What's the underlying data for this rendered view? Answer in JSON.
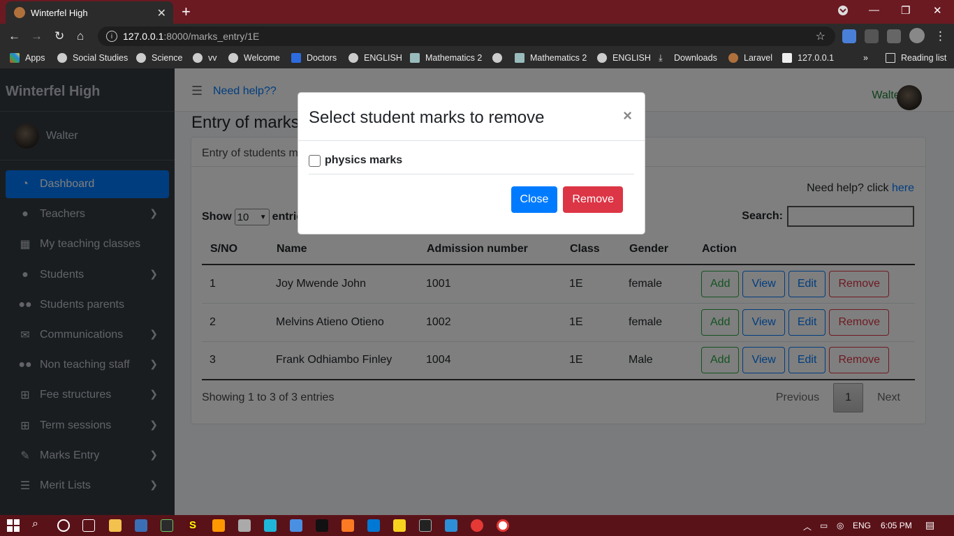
{
  "browser": {
    "tab_title": "Winterfel High",
    "tab_close": "✕",
    "new_tab": "+",
    "url_host": "127.0.0.1",
    "url_path": ":8000/marks_entry/1E",
    "bookmarks": [
      "Apps",
      "Social Studies",
      "Science",
      "vv",
      "Welcome",
      "Doctors",
      "ENGLISH",
      "Mathematics 2",
      "Mathematics 2",
      "ENGLISH",
      "Downloads",
      "Laravel",
      "127.0.0.1"
    ],
    "more": "»",
    "reading_list": "Reading list"
  },
  "sidebar": {
    "brand": "Winterfel High",
    "user": "Walter",
    "items": [
      {
        "label": "Dashboard",
        "icon": "dashboard-icon"
      },
      {
        "label": "Teachers",
        "icon": "user-icon"
      },
      {
        "label": "My teaching classes",
        "icon": "grid-icon"
      },
      {
        "label": "Students",
        "icon": "user-icon"
      },
      {
        "label": "Students parents",
        "icon": "users-icon"
      },
      {
        "label": "Communications",
        "icon": "envelope-icon"
      },
      {
        "label": "Non teaching staff",
        "icon": "users-icon"
      },
      {
        "label": "Fee structures",
        "icon": "table-icon"
      },
      {
        "label": "Term sessions",
        "icon": "table-icon"
      },
      {
        "label": "Marks Entry",
        "icon": "edit-icon"
      },
      {
        "label": "Merit Lists",
        "icon": "list-icon"
      }
    ]
  },
  "topnav": {
    "help_link": "Need help??",
    "user": "Walter"
  },
  "page": {
    "title": "Entry of marks",
    "card_header": "Entry of students marks",
    "help_text": "Need help? click",
    "help_link": "here",
    "show_label": "Show",
    "show_value": "10",
    "entries_label": "entries",
    "search_label": "Search:",
    "columns": [
      "S/NO",
      "Name",
      "Admission number",
      "Class",
      "Gender",
      "Action"
    ],
    "rows": [
      {
        "sno": "1",
        "name": "Joy Mwende John",
        "adm": "1001",
        "class": "1E",
        "gender": "female"
      },
      {
        "sno": "2",
        "name": "Melvins Atieno Otieno",
        "adm": "1002",
        "class": "1E",
        "gender": "female"
      },
      {
        "sno": "3",
        "name": "Frank Odhiambo Finley",
        "adm": "1004",
        "class": "1E",
        "gender": "Male"
      }
    ],
    "action_labels": {
      "add": "Add",
      "view": "View",
      "edit": "Edit",
      "remove": "Remove"
    },
    "info": "Showing 1 to 3 of 3 entries",
    "pagination": {
      "previous": "Previous",
      "current": "1",
      "next": "Next"
    }
  },
  "modal": {
    "title": "Select student marks to remove",
    "close_x": "×",
    "checkbox_label": "physics marks",
    "close_button": "Close",
    "remove_button": "Remove"
  },
  "taskbar": {
    "lang": "ENG",
    "time": "6:05 PM"
  },
  "colors": {
    "primary": "#007bff",
    "danger": "#dc3545",
    "success": "#28a745",
    "sidebar": "#343a40",
    "titlebar": "#6b1a22"
  }
}
